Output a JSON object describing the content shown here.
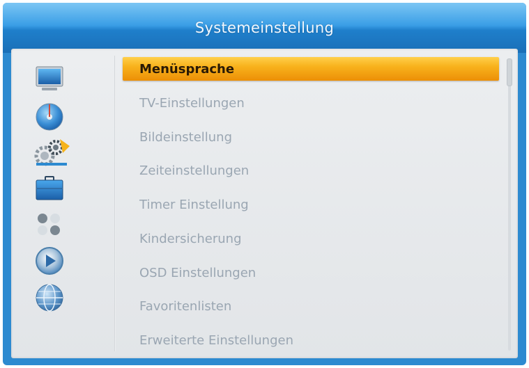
{
  "header": {
    "title": "Systemeinstellung"
  },
  "sidebar": {
    "icons": [
      {
        "name": "tv-screen-icon",
        "meaning": "display"
      },
      {
        "name": "disc-icon",
        "meaning": "media"
      },
      {
        "name": "settings-gears-icon",
        "meaning": "system-settings",
        "active": true
      },
      {
        "name": "briefcase-icon",
        "meaning": "tools"
      },
      {
        "name": "games-icon",
        "meaning": "games"
      },
      {
        "name": "media-player-icon",
        "meaning": "player"
      },
      {
        "name": "globe-icon",
        "meaning": "network"
      }
    ]
  },
  "menu": {
    "selected_index": 0,
    "items": [
      {
        "label": "Menüsprache"
      },
      {
        "label": "TV-Einstellungen"
      },
      {
        "label": "Bildeinstellung"
      },
      {
        "label": "Zeiteinstellungen"
      },
      {
        "label": "Timer Einstellung"
      },
      {
        "label": "Kindersicherung"
      },
      {
        "label": "OSD Einstellungen"
      },
      {
        "label": "Favoritenlisten"
      },
      {
        "label": "Erweiterte Einstellungen"
      }
    ]
  },
  "colors": {
    "accent": "#f8b21c",
    "frame": "#2d8ad0",
    "text_inactive": "#9aa6b2"
  }
}
